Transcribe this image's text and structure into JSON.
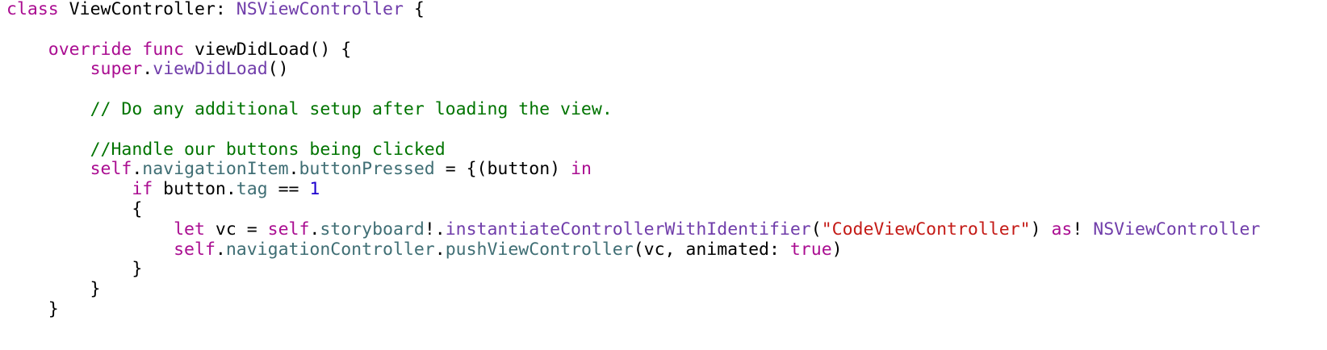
{
  "editor": {
    "colors": {
      "keyword": "#aa0d91",
      "type": "#703daa",
      "property": "#3f6e74",
      "comment": "#007400",
      "string": "#c41a16",
      "number": "#1c00cf",
      "plain": "#000000"
    },
    "lines": [
      [
        {
          "t": "class",
          "k": "kw"
        },
        {
          "t": " ViewController: ",
          "k": "pl"
        },
        {
          "t": "NSViewController",
          "k": "ty"
        },
        {
          "t": " {",
          "k": "pl"
        }
      ],
      [],
      [
        {
          "t": "    ",
          "k": "pl"
        },
        {
          "t": "override",
          "k": "kw"
        },
        {
          "t": " ",
          "k": "pl"
        },
        {
          "t": "func",
          "k": "kw"
        },
        {
          "t": " viewDidLoad() {",
          "k": "pl"
        }
      ],
      [
        {
          "t": "        ",
          "k": "pl"
        },
        {
          "t": "super",
          "k": "kw"
        },
        {
          "t": ".",
          "k": "pl"
        },
        {
          "t": "viewDidLoad",
          "k": "ty"
        },
        {
          "t": "()",
          "k": "pl"
        }
      ],
      [],
      [
        {
          "t": "        ",
          "k": "pl"
        },
        {
          "t": "// Do any additional setup after loading the view.",
          "k": "cm"
        }
      ],
      [],
      [
        {
          "t": "        ",
          "k": "pl"
        },
        {
          "t": "//Handle our buttons being clicked",
          "k": "cm"
        }
      ],
      [
        {
          "t": "        ",
          "k": "pl"
        },
        {
          "t": "self",
          "k": "kw"
        },
        {
          "t": ".",
          "k": "pl"
        },
        {
          "t": "navigationItem",
          "k": "pr"
        },
        {
          "t": ".",
          "k": "pl"
        },
        {
          "t": "buttonPressed",
          "k": "pr"
        },
        {
          "t": " = {(button) ",
          "k": "pl"
        },
        {
          "t": "in",
          "k": "kw"
        }
      ],
      [
        {
          "t": "            ",
          "k": "pl"
        },
        {
          "t": "if",
          "k": "kw"
        },
        {
          "t": " button.",
          "k": "pl"
        },
        {
          "t": "tag",
          "k": "pr"
        },
        {
          "t": " == ",
          "k": "pl"
        },
        {
          "t": "1",
          "k": "nu"
        }
      ],
      [
        {
          "t": "            {",
          "k": "pl"
        }
      ],
      [
        {
          "t": "                ",
          "k": "pl"
        },
        {
          "t": "let",
          "k": "kw"
        },
        {
          "t": " vc = ",
          "k": "pl"
        },
        {
          "t": "self",
          "k": "kw"
        },
        {
          "t": ".",
          "k": "pl"
        },
        {
          "t": "storyboard",
          "k": "pr"
        },
        {
          "t": "!.",
          "k": "pl"
        },
        {
          "t": "instantiateControllerWithIdentifier",
          "k": "ty"
        },
        {
          "t": "(",
          "k": "pl"
        },
        {
          "t": "\"CodeViewController\"",
          "k": "st"
        },
        {
          "t": ") ",
          "k": "pl"
        },
        {
          "t": "as",
          "k": "kw"
        },
        {
          "t": "! ",
          "k": "pl"
        },
        {
          "t": "NSViewController",
          "k": "ty"
        }
      ],
      [
        {
          "t": "                ",
          "k": "pl"
        },
        {
          "t": "self",
          "k": "kw"
        },
        {
          "t": ".",
          "k": "pl"
        },
        {
          "t": "navigationController",
          "k": "pr"
        },
        {
          "t": ".",
          "k": "pl"
        },
        {
          "t": "pushViewController",
          "k": "pr"
        },
        {
          "t": "(vc, animated: ",
          "k": "pl"
        },
        {
          "t": "true",
          "k": "kw"
        },
        {
          "t": ")",
          "k": "pl"
        }
      ],
      [
        {
          "t": "            }",
          "k": "pl"
        }
      ],
      [
        {
          "t": "        }",
          "k": "pl"
        }
      ],
      [
        {
          "t": "    }",
          "k": "pl"
        }
      ]
    ]
  }
}
